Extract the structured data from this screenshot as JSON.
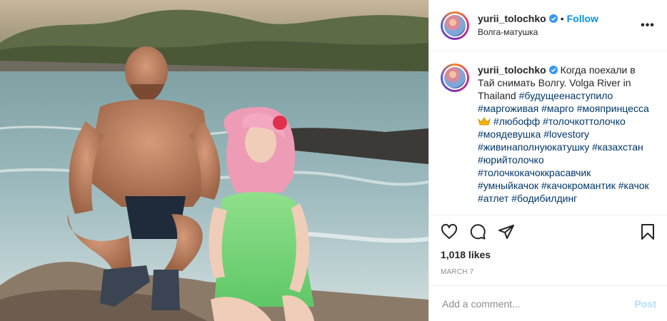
{
  "post": {
    "image_alt": "Photo of a man and a doll on rocks by the sea"
  },
  "header": {
    "username": "yurii_tolochko",
    "dot": "•",
    "follow_label": "Follow",
    "location": "Волга-матушка",
    "more_label": "•••"
  },
  "caption": {
    "username": "yurii_tolochko",
    "text": "Когда поехали в Тай снимать Волгу. Volga River in Thailand",
    "hashtags": [
      "#будущеенаступило",
      "#маргоживая",
      "#марго",
      "#мояпринцесса",
      "#любофф",
      "#толочкоттолочко",
      "#моядевушка",
      "#lovestory",
      "#живинаполнуюкатушку",
      "#казахстан",
      "#юрийтолочко",
      "#толочкокачоккрасавчик",
      "#умныйкачок",
      "#качокромантик",
      "#качок",
      "#атлет",
      "#бодибилдинг"
    ]
  },
  "stats": {
    "likes": "1,018 likes",
    "date": "MARCH 7"
  },
  "comment": {
    "placeholder": "Add a comment...",
    "post_label": "Post"
  },
  "icons": {
    "like": "heart-icon",
    "comment": "comment-icon",
    "share": "paper-plane-icon",
    "save": "bookmark-icon",
    "verified": "verified-badge-icon",
    "crown": "crown-emoji-icon"
  },
  "colors": {
    "link_blue": "#0095f6",
    "hashtag": "#00376b",
    "muted": "#8e8e8e",
    "border": "#efefef",
    "post_disabled": "#b2dffc"
  }
}
